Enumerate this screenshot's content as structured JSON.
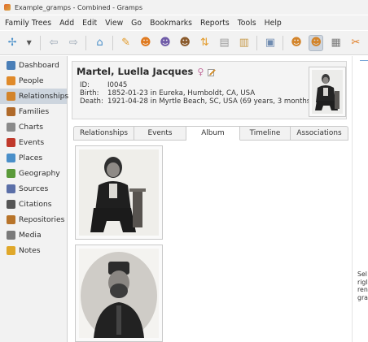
{
  "window": {
    "title": "Example_gramps - Combined - Gramps"
  },
  "menu": [
    "Family Trees",
    "Add",
    "Edit",
    "View",
    "Go",
    "Bookmarks",
    "Reports",
    "Tools",
    "Help"
  ],
  "toolbar": {
    "buttons": [
      {
        "name": "tree-view-icon",
        "glyph": "✢",
        "color": "#4a8fc9"
      },
      {
        "name": "dropdown-arrow-icon",
        "glyph": "▼",
        "color": "#555555"
      },
      {
        "name": "back-arrow-icon",
        "glyph": "⇦",
        "color": "#9aa7b5"
      },
      {
        "name": "forward-arrow-icon",
        "glyph": "⇨",
        "color": "#9aa7b5"
      },
      {
        "name": "home-icon",
        "glyph": "⌂",
        "color": "#4a8fc9"
      },
      {
        "name": "edit-person-icon",
        "glyph": "✎",
        "color": "#e39a28"
      },
      {
        "name": "add-person-icon",
        "glyph": "☻",
        "color": "#e07a1f"
      },
      {
        "name": "add-family-icon",
        "glyph": "☻",
        "color": "#6f5ba8"
      },
      {
        "name": "merge-people-icon",
        "glyph": "☻",
        "color": "#8a5a2b"
      },
      {
        "name": "sort-icon",
        "glyph": "⇅",
        "color": "#e39a28"
      },
      {
        "name": "clipboard-icon",
        "glyph": "▤",
        "color": "#9a9a9a"
      },
      {
        "name": "notes-clipboard-icon",
        "glyph": "▥",
        "color": "#c79a4a"
      },
      {
        "name": "report-icon",
        "glyph": "▣",
        "color": "#6f8bb0"
      },
      {
        "name": "family-view-icon",
        "glyph": "☻",
        "color": "#d3842a"
      },
      {
        "name": "relationship-view-icon",
        "glyph": "☻",
        "color": "#d3842a"
      },
      {
        "name": "print-icon",
        "glyph": "▦",
        "color": "#7a7a7a"
      },
      {
        "name": "scissors-icon",
        "glyph": "✂",
        "color": "#e07a1f"
      }
    ]
  },
  "sidebar": {
    "items": [
      {
        "label": "Dashboard",
        "icon": "dashboard-icon",
        "color": "#4a7fb8"
      },
      {
        "label": "People",
        "icon": "people-icon",
        "color": "#e08a2a"
      },
      {
        "label": "Relationships",
        "icon": "relationships-icon",
        "color": "#d3842a",
        "selected": true
      },
      {
        "label": "Families",
        "icon": "families-icon",
        "color": "#b06a2a"
      },
      {
        "label": "Charts",
        "icon": "charts-icon",
        "color": "#8a8a8a"
      },
      {
        "label": "Events",
        "icon": "events-icon",
        "color": "#c0392b"
      },
      {
        "label": "Places",
        "icon": "places-icon",
        "color": "#4a8fc9"
      },
      {
        "label": "Geography",
        "icon": "geography-icon",
        "color": "#5a9a3a"
      },
      {
        "label": "Sources",
        "icon": "sources-icon",
        "color": "#5b6fa8"
      },
      {
        "label": "Citations",
        "icon": "citations-icon",
        "color": "#555555"
      },
      {
        "label": "Repositories",
        "icon": "repositories-icon",
        "color": "#b8742a"
      },
      {
        "label": "Media",
        "icon": "media-icon",
        "color": "#7a7a7a"
      },
      {
        "label": "Notes",
        "icon": "notes-icon",
        "color": "#e0a82a"
      }
    ]
  },
  "person": {
    "name": "Martel, Luella Jacques",
    "gender_symbol": "♀",
    "id_label": "ID:",
    "id": "I0045",
    "birth_label": "Birth:",
    "birth": "1852-01-23 in Eureka, Humboldt, CA, USA",
    "death_label": "Death:",
    "death": "1921-04-28 in Myrtle Beach, SC, USA (69 years, 3 months)"
  },
  "tabs": [
    {
      "label": "Relationships"
    },
    {
      "label": "Events"
    },
    {
      "label": "Album",
      "active": true
    },
    {
      "label": "Timeline"
    },
    {
      "label": "Associations"
    }
  ],
  "side_hint_lines": [
    "Sel",
    "rigl",
    "ren",
    "gra"
  ]
}
